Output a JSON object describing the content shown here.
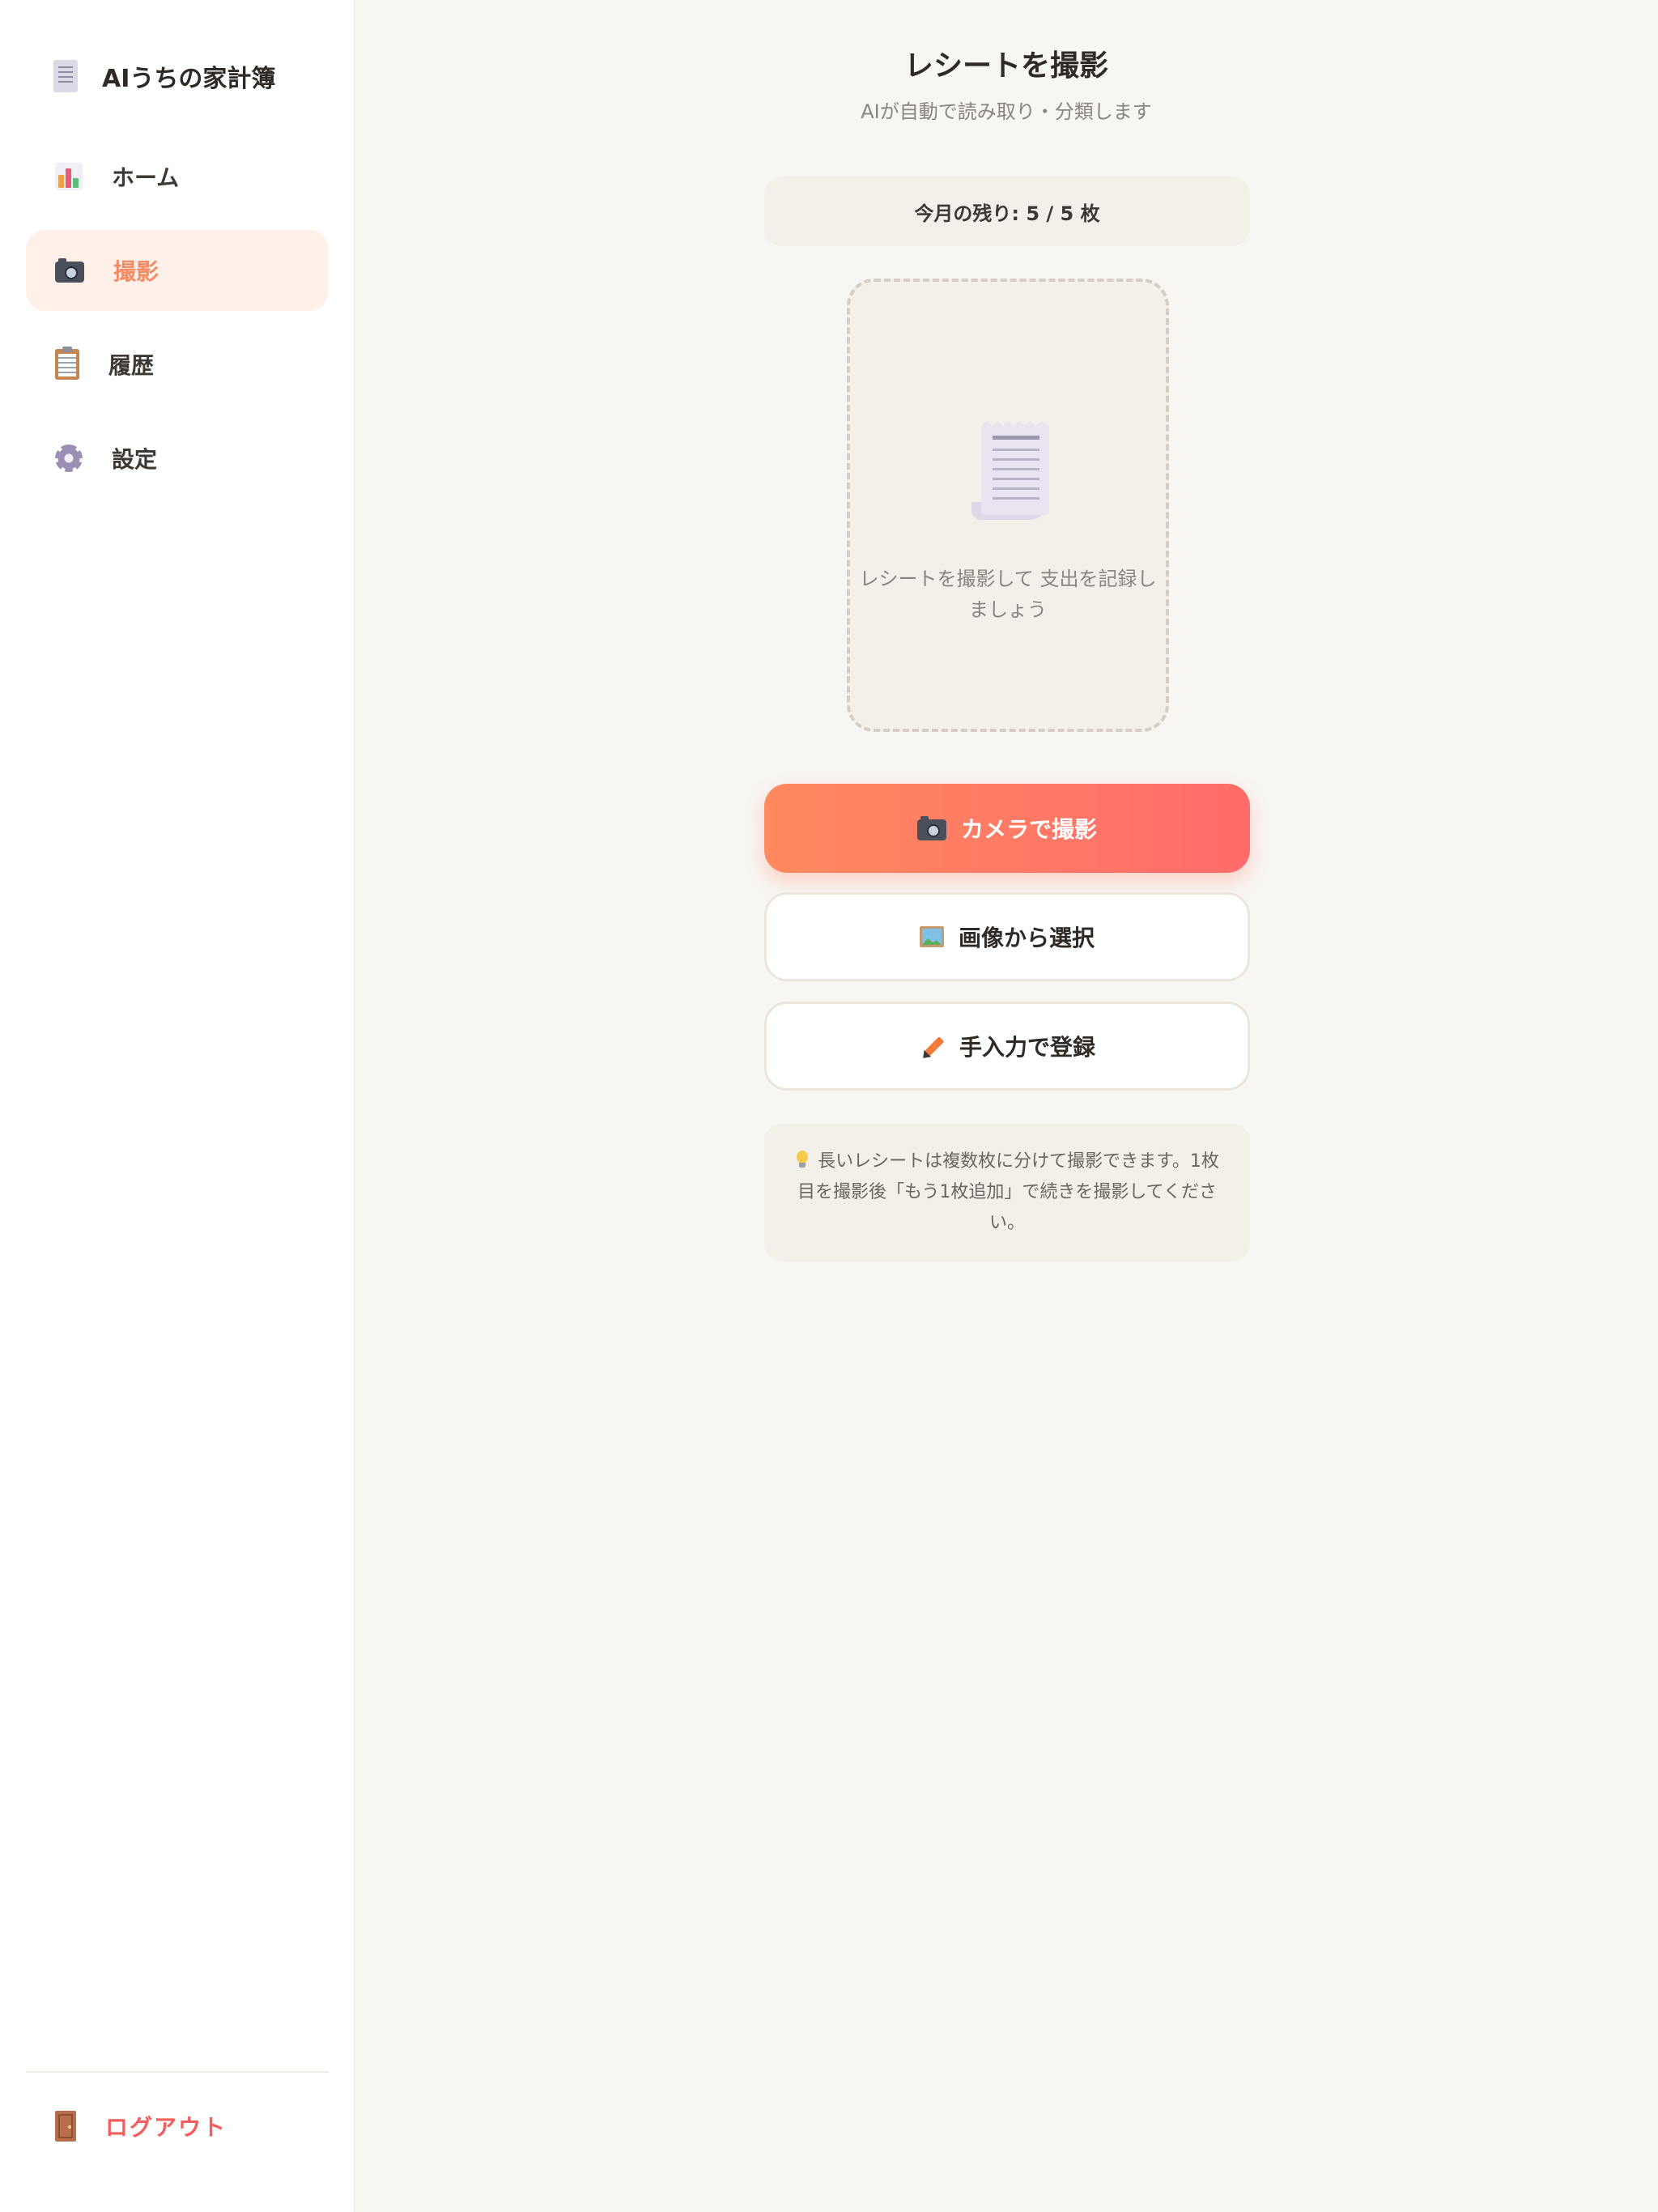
{
  "app": {
    "title": "AIうちの家計簿"
  },
  "sidebar": {
    "items": [
      {
        "label": "ホーム",
        "icon": "chart-icon",
        "active": false
      },
      {
        "label": "撮影",
        "icon": "camera-icon",
        "active": true
      },
      {
        "label": "履歴",
        "icon": "clipboard-icon",
        "active": false
      },
      {
        "label": "設定",
        "icon": "gear-icon",
        "active": false
      }
    ],
    "logout_label": "ログアウト"
  },
  "main": {
    "title": "レシートを撮影",
    "subtitle": "AIが自動で読み取り・分類します",
    "quota_text": "今月の残り: 5 / 5 枚",
    "drop_zone_text": "レシートを撮影して 支出を記録しましょう",
    "buttons": {
      "camera": "カメラで撮影",
      "image": "画像から選択",
      "manual": "手入力で登録"
    },
    "tip_text": "長いレシートは複数枚に分けて撮影できます。1枚目を撮影後「もう1枚追加」で続きを撮影してください。"
  },
  "colors": {
    "accent": "#f58a63",
    "primary_gradient_start": "#ff8a5e",
    "primary_gradient_end": "#ff6b6b",
    "logout": "#f25e5e",
    "background": "#f8f6f2"
  }
}
